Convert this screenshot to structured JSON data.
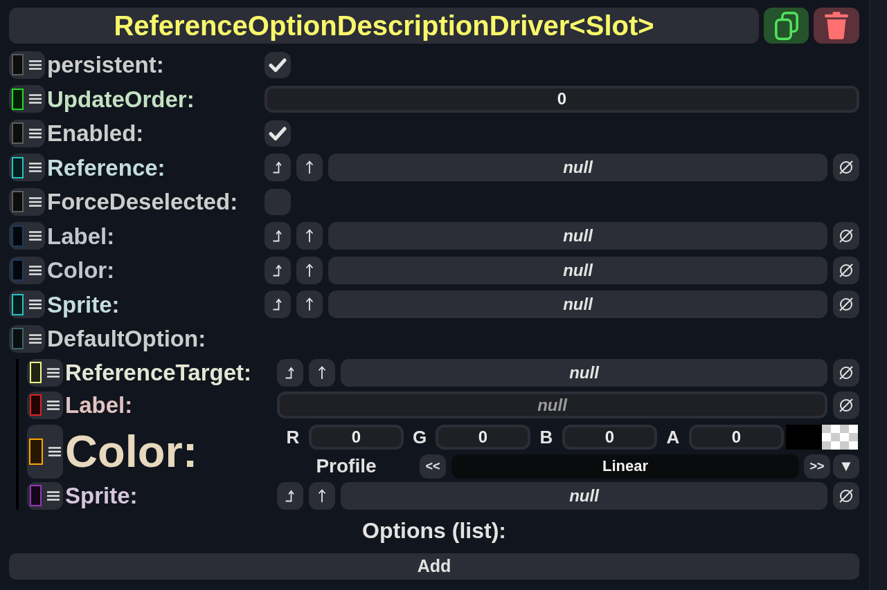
{
  "header": {
    "title": "ReferenceOptionDescriptionDriver<Slot>"
  },
  "fields": [
    {
      "kind": "checkbox",
      "label": "persistent:",
      "color": "#5c5c5c",
      "checked": true
    },
    {
      "kind": "number",
      "label": "UpdateOrder:",
      "color": "#22dd22",
      "value": "0"
    },
    {
      "kind": "checkbox",
      "label": "Enabled:",
      "color": "#5c5c5c",
      "checked": true
    },
    {
      "kind": "reference",
      "label": "Reference:",
      "color": "#22c4c8",
      "value": "null"
    },
    {
      "kind": "checkbox",
      "label": "ForceDeselected:",
      "color": "#5c5c5c",
      "checked": false
    },
    {
      "kind": "reference",
      "label": "Label:",
      "color": "#1e3a5f",
      "value": "null"
    },
    {
      "kind": "reference",
      "label": "Color:",
      "color": "#1e3a5f",
      "value": "null"
    },
    {
      "kind": "reference",
      "label": "Sprite:",
      "color": "#22c4c8",
      "value": "null"
    },
    {
      "kind": "group",
      "label": "DefaultOption:",
      "color": "#3d6468",
      "children": [
        {
          "kind": "reference",
          "label": "ReferenceTarget:",
          "color": "#eeff88",
          "value": "null"
        },
        {
          "kind": "text",
          "label": "Label:",
          "color": "#dd2222",
          "value": "null"
        },
        {
          "kind": "color",
          "label": "Color:",
          "color": "#ffa500",
          "channels": [
            {
              "name": "R",
              "value": "0"
            },
            {
              "name": "G",
              "value": "0"
            },
            {
              "name": "B",
              "value": "0"
            },
            {
              "name": "A",
              "value": "0"
            }
          ],
          "profile": {
            "label": "Profile",
            "prev": "<<",
            "value": "Linear",
            "next": ">>",
            "dropdown": "▼"
          }
        },
        {
          "kind": "reference",
          "label": "Sprite:",
          "color": "#9933bb",
          "value": "null"
        }
      ]
    }
  ],
  "list": {
    "label": "Options (list):",
    "add_button": "Add"
  }
}
